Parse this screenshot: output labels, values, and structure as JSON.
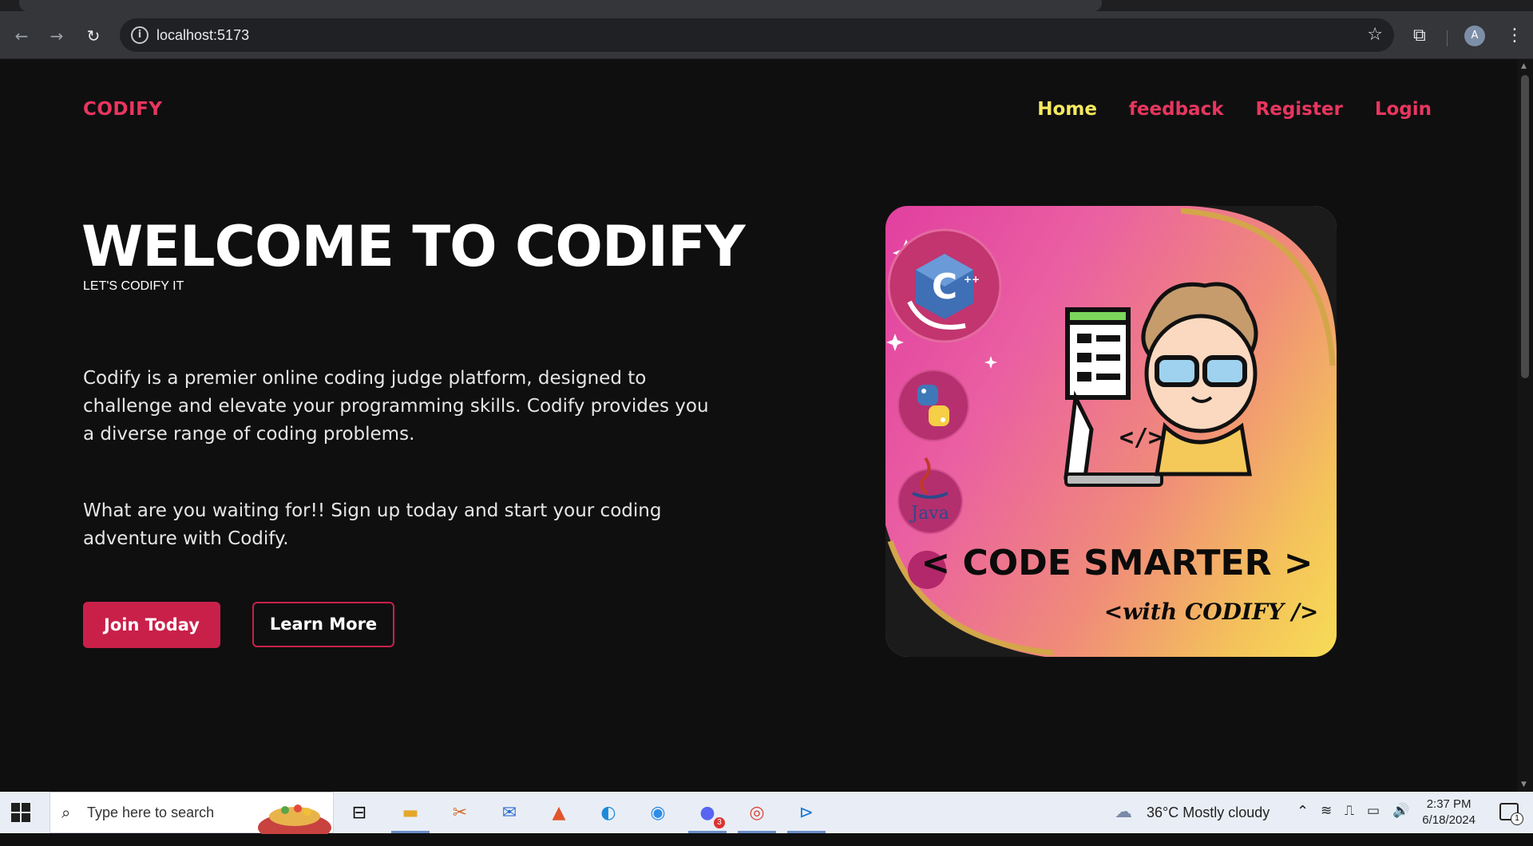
{
  "browser": {
    "url": "localhost:5173",
    "profile_initial": "A"
  },
  "site": {
    "brand": "CODIFY",
    "nav": [
      {
        "label": "Home",
        "active": true
      },
      {
        "label": "feedback",
        "active": false
      },
      {
        "label": "Register",
        "active": false
      },
      {
        "label": "Login",
        "active": false
      }
    ],
    "hero": {
      "title": "WELCOME TO CODIFY",
      "subtitle": "LET'S CODIFY IT",
      "paragraph1": "Codify is a premier online coding judge platform, designed to challenge and elevate your programming skills. Codify provides you a diverse range of coding problems.",
      "paragraph2": "What are you waiting for!! Sign up today and start your coding adventure with Codify.",
      "join_button": "Join Today",
      "learn_button": "Learn More"
    },
    "banner": {
      "headline": "< CODE SMARTER >",
      "tagline": "<with CODIFY />",
      "language_badges": [
        "C++",
        "Python",
        "Java"
      ],
      "code_symbol": "</>",
      "cpp_letter": "C",
      "java_label": "Java"
    },
    "colors": {
      "accent": "#e8365f",
      "active_nav": "#f5e960",
      "button": "#c9204a",
      "background": "#0f0f10"
    }
  },
  "taskbar": {
    "search_placeholder": "Type here to search",
    "weather": "36°C  Mostly cloudy",
    "time": "2:37 PM",
    "date": "6/18/2024",
    "notification_count": "1",
    "mail_badge": "3",
    "apps": [
      "task-view-icon",
      "file-explorer-icon",
      "snipping-icon",
      "mail-icon",
      "matlab-icon",
      "edge-icon",
      "docker-icon",
      "discord-icon",
      "chrome-icon",
      "vscode-icon"
    ]
  }
}
